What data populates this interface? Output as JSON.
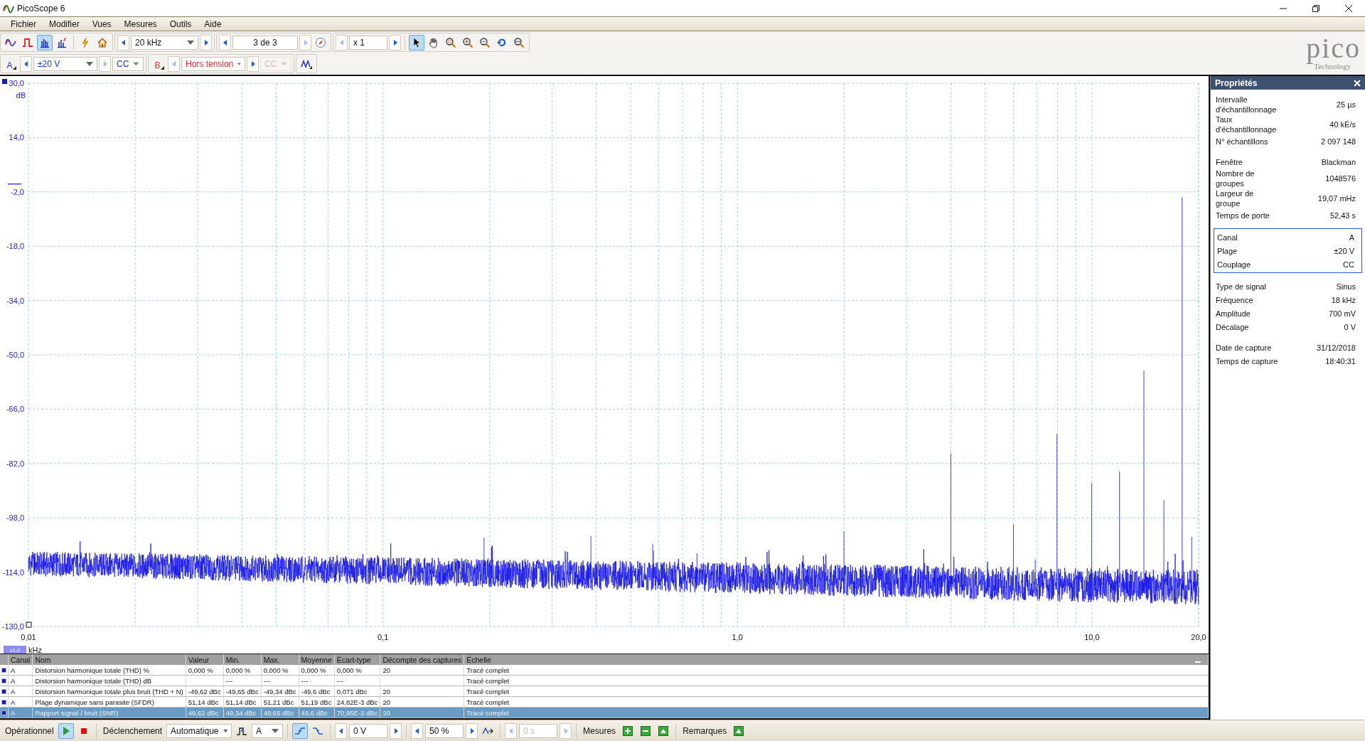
{
  "window": {
    "title": "PicoScope 6"
  },
  "menu": [
    "Fichier",
    "Modifier",
    "Vues",
    "Mesures",
    "Outils",
    "Aide"
  ],
  "toolbar": {
    "view_modes": [
      {
        "kind": "scope",
        "selected": false
      },
      {
        "kind": "persistence",
        "selected": false
      },
      {
        "kind": "spectrum",
        "selected": true
      },
      {
        "kind": "mso",
        "selected": false
      }
    ],
    "actions": [
      {
        "kind": "auto-setup"
      },
      {
        "kind": "home"
      }
    ],
    "timebase": {
      "value": "20 kHz"
    },
    "capture": {
      "value": "3 de 3",
      "prev_disabled": false,
      "next_disabled": true
    },
    "zoom": {
      "value": "x 1",
      "prev_disabled": true,
      "next_disabled": false
    },
    "tools": [
      {
        "kind": "pointer",
        "selected": true
      },
      {
        "kind": "hand",
        "selected": false
      },
      {
        "kind": "zoom-area",
        "selected": false
      },
      {
        "kind": "zoom-in",
        "selected": false
      },
      {
        "kind": "zoom-out",
        "selected": false
      },
      {
        "kind": "undo",
        "selected": false
      },
      {
        "kind": "zoom-fit",
        "selected": false
      }
    ]
  },
  "logo": {
    "name": "pico",
    "tagline": "Technology"
  },
  "channels": [
    {
      "name": "A",
      "color": "#1c34e8",
      "range": "±20 V",
      "coupling": "CC",
      "enabled": true,
      "prev_disabled": false,
      "next_disabled": true
    },
    {
      "name": "B",
      "color": "#e82828",
      "range": "Hors tension",
      "coupling": "CC",
      "enabled": false,
      "prev_disabled": true,
      "next_disabled": false
    }
  ],
  "graph": {
    "y_unit": "dB",
    "y_ticks": [
      "30,0",
      "14,0",
      "-2,0",
      "-18,0",
      "-34,0",
      "-50,0",
      "-66,0",
      "-82,0",
      "-98,0",
      "-114,0",
      "-130,0"
    ],
    "x_ticks": [
      "0,01",
      "0,1",
      "1,0",
      "10,0",
      "20,0"
    ],
    "x_scale": "x1,0",
    "x_unit": "kHz"
  },
  "properties": {
    "title": "Propriétés",
    "groups": [
      {
        "boxed": false,
        "rows": [
          {
            "label": "Intervalle\nd'échantillonnage",
            "value": "25 µs"
          },
          {
            "label": "Taux\nd'échantillonnage",
            "value": "40 kÉ/s"
          },
          {
            "label": "N° échantillons",
            "value": "2 097 148"
          }
        ]
      },
      {
        "boxed": false,
        "rows": [
          {
            "label": "Fenêtre",
            "value": "Blackman"
          },
          {
            "label": "Nombre de\ngroupes",
            "value": "1048576"
          },
          {
            "label": "Largeur de\ngroupe",
            "value": "19,07 mHz"
          },
          {
            "label": "Temps de porte",
            "value": "52,43 s"
          }
        ]
      },
      {
        "boxed": true,
        "rows": [
          {
            "label": "Canal",
            "value": "A"
          },
          {
            "label": "Plage",
            "value": "±20 V"
          },
          {
            "label": "Couplage",
            "value": "CC"
          }
        ]
      },
      {
        "boxed": false,
        "rows": [
          {
            "label": "Type de signal",
            "value": "Sinus"
          },
          {
            "label": "Fréquence",
            "value": "18 kHz"
          },
          {
            "label": "Amplitude",
            "value": "700 mV"
          },
          {
            "label": "Décalage",
            "value": "0 V"
          }
        ]
      },
      {
        "boxed": false,
        "rows": [
          {
            "label": "Date de capture",
            "value": "31/12/2018"
          },
          {
            "label": "Temps de capture",
            "value": "18:40:31"
          }
        ]
      }
    ]
  },
  "measurements": {
    "columns": [
      "Canal",
      "Nom",
      "Valeur",
      "Min.",
      "Max.",
      "Moyenne",
      "Écart-type",
      "Décompte des captures",
      "Échelle"
    ],
    "rows": [
      {
        "selected": false,
        "cells": [
          "A",
          "Distorsion harmonique totale (THD) %",
          "0,000 %",
          "0,000 %",
          "0,000 %",
          "0,000 %",
          "0,000 %",
          "20",
          "Tracé complet"
        ]
      },
      {
        "selected": false,
        "cells": [
          "A",
          "Distorsion harmonique totale (THD) dB",
          null,
          "---",
          "---",
          "---",
          "---",
          null,
          "Tracé complet"
        ]
      },
      {
        "selected": false,
        "cells": [
          "A",
          "Distorsion harmonique totale plus bruit (THD + N)",
          "-49,62 dBc",
          "-49,65 dBc",
          "-49,34 dBc",
          "-49,6 dBc",
          "0,071 dBc",
          "20",
          "Tracé complet"
        ]
      },
      {
        "selected": false,
        "cells": [
          "A",
          "Plage dynamique sans parasite (SFDR)",
          "51,14 dBc",
          "51,14 dBc",
          "51,21 dBc",
          "51,19 dBc",
          "24,82E-3 dBc",
          "20",
          "Tracé complet"
        ]
      },
      {
        "selected": true,
        "cells": [
          "A",
          "Rapport signal / bruit (SNR)",
          "49,62 dBc",
          "49,34 dBc",
          "49,65 dBc",
          "49,6 dBc",
          "70,95E-3 dBc",
          "20",
          "Tracé complet"
        ]
      }
    ]
  },
  "status": {
    "run_label": "Opérationnel",
    "running": true,
    "trigger_label": "Déclenchement",
    "trigger_mode": "Automatique",
    "trigger_channel": "A",
    "edges": [
      {
        "kind": "rising",
        "selected": true
      },
      {
        "kind": "falling",
        "selected": false
      }
    ],
    "threshold": "0 V",
    "pretrigger": "50 %",
    "delay": "0 s",
    "delay_disabled": true,
    "measures_label": "Mesures",
    "notes_label": "Remarques"
  }
}
